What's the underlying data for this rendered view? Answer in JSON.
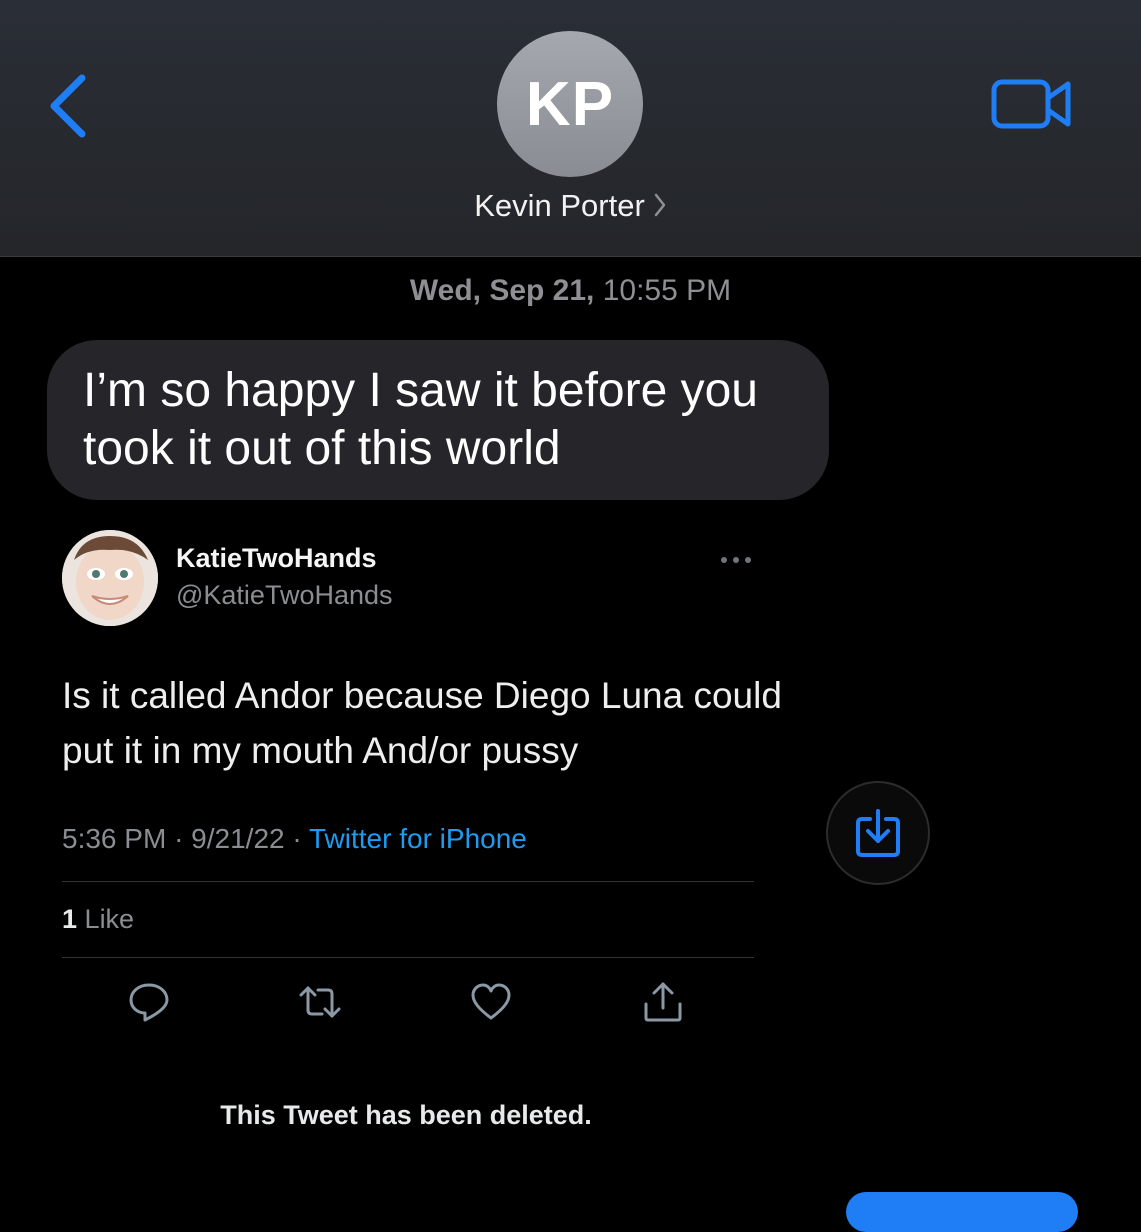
{
  "header": {
    "avatar_initials": "KP",
    "contact_name": "Kevin Porter",
    "back_icon": "chevron-left-icon",
    "video_icon": "video-camera-icon",
    "accent_color": "#1f7ef5"
  },
  "conversation": {
    "timestamp_day": "Wed, Sep 21,",
    "timestamp_time": "10:55 PM",
    "message_text": "I’m so happy I saw it before you took it out of this world"
  },
  "tweet": {
    "display_name": "KatieTwoHands",
    "handle": "@KatieTwoHands",
    "text": "Is it called Andor because Diego Luna could put it in my mouth And/or pussy",
    "time": "5:36 PM",
    "date": "9/21/22",
    "separator": "·",
    "source": "Twitter for iPhone",
    "like_count": "1",
    "like_label": "Like",
    "deleted_notice": "This Tweet has been deleted.",
    "source_color": "#1d9bf0",
    "actions": [
      "reply-icon",
      "retweet-icon",
      "like-icon",
      "share-icon"
    ]
  },
  "save_button_icon": "save-download-icon"
}
